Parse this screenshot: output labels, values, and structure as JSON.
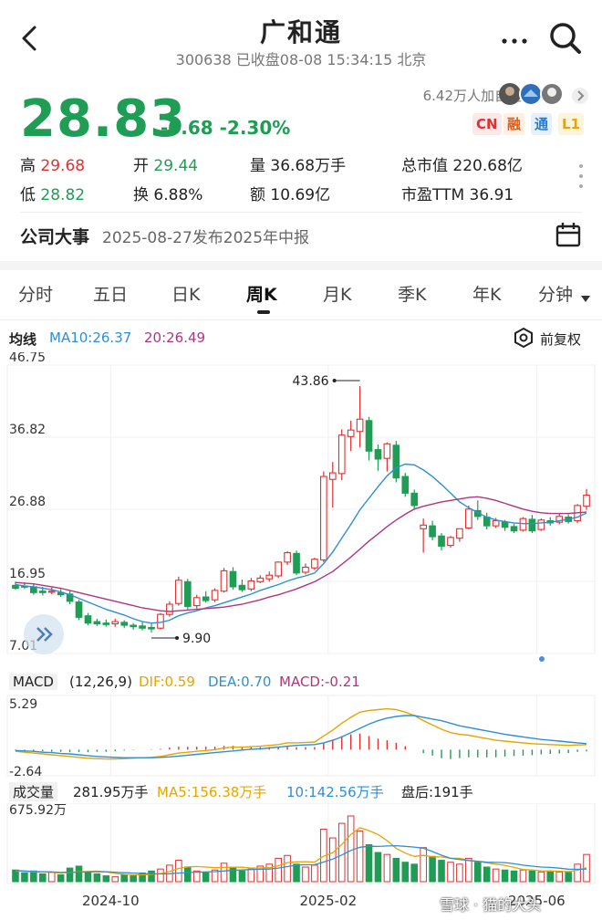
{
  "header": {
    "title": "广和通",
    "subtitle": "300638 已收盘08-08 15:34:15 北京",
    "back_icon": "back-arrow-icon",
    "more_icon": "more-dots-icon",
    "search_icon": "search-icon"
  },
  "quote": {
    "price": "28.83",
    "change": "-0.68 -2.30%",
    "followers": "6.42万人加自选",
    "badges": [
      "CN",
      "融",
      "通",
      "L1"
    ],
    "badge_colors": [
      "#e03131",
      "#e8590c",
      "#1c7ed6",
      "#e8a400"
    ],
    "stats": [
      {
        "label": "高",
        "value": "29.68",
        "color": "#e03131"
      },
      {
        "label": "开",
        "value": "29.44",
        "color": "#1f9d55"
      },
      {
        "label": "量",
        "value": "36.68万手",
        "color": "#222"
      },
      {
        "label": "总市值",
        "value": "220.68亿",
        "color": "#222"
      },
      {
        "label": "低",
        "value": "28.82",
        "color": "#1f9d55"
      },
      {
        "label": "换",
        "value": "6.88%",
        "color": "#222"
      },
      {
        "label": "额",
        "value": "10.69亿",
        "color": "#222"
      },
      {
        "label": "市盈TTM",
        "value": "36.91",
        "color": "#222"
      }
    ]
  },
  "event": {
    "label": "公司大事",
    "text": "2025-08-27发布2025年中报",
    "icon": "calendar-icon"
  },
  "tabs": [
    "分时",
    "五日",
    "日K",
    "周K",
    "月K",
    "季K",
    "年K",
    "分钟"
  ],
  "active_tab": "周K",
  "tab_dropdown_icon": "triangle-down-icon",
  "ma_bar": {
    "label": "均线",
    "ma10": "MA10:26.37",
    "ma20": "20:26.49",
    "restore": "前复权",
    "restore_icon": "hexagon-settings-icon",
    "colors": {
      "ma10": "#2f8fd6",
      "ma20": "#b0357f"
    }
  },
  "macd_bar": {
    "label": "MACD",
    "params": "(12,26,9)",
    "dif": "DIF:0.59",
    "dea": "DEA:0.70",
    "macd": "MACD:-0.21",
    "colors": {
      "dif": "#e8a400",
      "dea": "#2f8fd6",
      "macd": "#b0357f"
    }
  },
  "volume_bar": {
    "label": "成交量",
    "vol": "281.95万手",
    "ma5": "MA5:156.38万手",
    "ma10": "10:142.56万手",
    "after": "盘后:191手",
    "colors": {
      "ma5": "#e8a400",
      "ma10": "#2f8fd6"
    }
  },
  "watermark": "雪球 · 猫的大头",
  "chart_data": {
    "type": "candlestick",
    "price_axis": {
      "labels": [
        "46.75",
        "36.82",
        "26.88",
        "16.95",
        "7.01"
      ],
      "range": [
        7.01,
        46.75
      ]
    },
    "annotations": {
      "high": "43.86",
      "low": "9.90"
    },
    "candles": [
      [
        16.4,
        16.9,
        16.0,
        15.8
      ],
      [
        16.3,
        16.8,
        16.2,
        15.9
      ],
      [
        16.2,
        16.7,
        15.4,
        15.1
      ],
      [
        15.6,
        16.2,
        15.4,
        15.0
      ],
      [
        15.6,
        16.1,
        15.6,
        15.2
      ],
      [
        15.4,
        15.9,
        15.1,
        14.8
      ],
      [
        15.2,
        15.6,
        14.2,
        13.8
      ],
      [
        14.1,
        14.4,
        12.0,
        11.6
      ],
      [
        12.2,
        12.6,
        11.2,
        10.9
      ],
      [
        11.4,
        11.8,
        11.1,
        10.8
      ],
      [
        11.2,
        11.7,
        11.0,
        10.7
      ],
      [
        11.1,
        11.8,
        11.4,
        10.7
      ],
      [
        11.3,
        11.6,
        10.9,
        10.5
      ],
      [
        10.9,
        11.2,
        10.7,
        10.3
      ],
      [
        10.8,
        11.3,
        10.5,
        10.2
      ],
      [
        10.6,
        11.1,
        10.4,
        9.9
      ],
      [
        10.5,
        12.6,
        12.4,
        10.3
      ],
      [
        12.4,
        14.2,
        13.8,
        12.1
      ],
      [
        13.9,
        17.6,
        17.1,
        13.6
      ],
      [
        16.9,
        17.3,
        13.5,
        13.1
      ],
      [
        13.6,
        15.1,
        14.7,
        13.2
      ],
      [
        14.8,
        15.6,
        14.3,
        14.0
      ],
      [
        14.4,
        16.0,
        15.7,
        14.1
      ],
      [
        15.6,
        18.8,
        18.4,
        15.4
      ],
      [
        18.3,
        18.9,
        16.2,
        15.8
      ],
      [
        16.4,
        17.2,
        15.8,
        15.5
      ],
      [
        15.9,
        17.4,
        17.0,
        15.6
      ],
      [
        16.9,
        17.8,
        17.4,
        16.7
      ],
      [
        17.3,
        18.3,
        17.8,
        16.9
      ],
      [
        17.7,
        19.7,
        19.6,
        17.4
      ],
      [
        19.6,
        21.1,
        20.9,
        19.2
      ],
      [
        20.8,
        21.2,
        18.1,
        17.8
      ],
      [
        18.2,
        19.4,
        18.9,
        17.9
      ],
      [
        18.8,
        20.2,
        20.0,
        18.5
      ],
      [
        19.9,
        32.1,
        31.4,
        19.6
      ],
      [
        31.0,
        33.4,
        31.9,
        27.1
      ],
      [
        31.8,
        37.9,
        37.1,
        30.9
      ],
      [
        36.9,
        39.1,
        37.8,
        34.9
      ],
      [
        37.6,
        43.86,
        39.3,
        35.4
      ],
      [
        39.1,
        39.6,
        34.9,
        33.6
      ],
      [
        35.1,
        35.8,
        33.8,
        32.2
      ],
      [
        33.9,
        36.1,
        35.9,
        32.1
      ],
      [
        35.7,
        36.3,
        31.2,
        30.6
      ],
      [
        31.4,
        31.9,
        29.1,
        28.6
      ],
      [
        29.1,
        29.6,
        27.4,
        26.8
      ],
      [
        24.2,
        25.6,
        24.7,
        20.9
      ],
      [
        24.6,
        25.3,
        23.1,
        22.6
      ],
      [
        23.2,
        23.6,
        21.8,
        21.2
      ],
      [
        21.9,
        23.2,
        23.0,
        21.6
      ],
      [
        22.9,
        23.4,
        24.2,
        22.4
      ],
      [
        24.3,
        27.4,
        26.9,
        24.1
      ],
      [
        26.7,
        28.1,
        25.9,
        25.4
      ],
      [
        25.8,
        26.4,
        24.6,
        24.1
      ],
      [
        24.6,
        25.7,
        25.3,
        24.3
      ],
      [
        25.1,
        25.4,
        24.4,
        23.9
      ],
      [
        24.5,
        24.9,
        23.9,
        23.6
      ],
      [
        24.0,
        25.8,
        25.6,
        23.8
      ],
      [
        25.5,
        26.1,
        23.9,
        23.6
      ],
      [
        24.1,
        25.6,
        25.4,
        23.9
      ],
      [
        25.3,
        25.8,
        25.0,
        24.6
      ],
      [
        25.1,
        26.3,
        25.9,
        24.8
      ],
      [
        25.8,
        26.2,
        25.2,
        24.9
      ],
      [
        25.3,
        27.6,
        27.4,
        25.0
      ],
      [
        27.3,
        29.68,
        28.83,
        26.8
      ]
    ],
    "ma10": [
      16.5,
      16.3,
      16.2,
      16.0,
      15.8,
      15.5,
      15.1,
      14.6,
      14.1,
      13.6,
      13.1,
      12.7,
      12.3,
      11.8,
      11.4,
      11.2,
      11.3,
      11.6,
      12.2,
      12.6,
      12.9,
      13.3,
      13.6,
      14.0,
      14.4,
      14.8,
      15.2,
      15.7,
      16.1,
      16.5,
      17.0,
      17.4,
      17.7,
      18.1,
      19.4,
      21.0,
      22.9,
      24.8,
      26.8,
      28.4,
      30.0,
      31.5,
      32.6,
      33.1,
      33.0,
      32.3,
      31.4,
      30.3,
      29.1,
      27.9,
      27.1,
      26.4,
      25.8,
      25.4,
      25.2,
      25.0,
      24.9,
      24.9,
      25.0,
      25.1,
      25.3,
      25.5,
      25.8,
      26.37
    ],
    "ma20": [
      16.8,
      16.7,
      16.6,
      16.4,
      16.2,
      16.0,
      15.7,
      15.4,
      15.1,
      14.8,
      14.5,
      14.2,
      13.9,
      13.6,
      13.3,
      13.1,
      12.9,
      12.8,
      12.9,
      13.0,
      13.1,
      13.2,
      13.3,
      13.4,
      13.6,
      13.8,
      14.1,
      14.4,
      14.8,
      15.1,
      15.5,
      15.9,
      16.4,
      16.9,
      17.6,
      18.3,
      19.3,
      20.3,
      21.4,
      22.5,
      23.5,
      24.5,
      25.4,
      26.2,
      26.9,
      27.3,
      27.6,
      27.9,
      28.1,
      28.3,
      28.5,
      28.6,
      28.4,
      28.1,
      27.7,
      27.3,
      26.9,
      26.6,
      26.4,
      26.3,
      26.3,
      26.3,
      26.4,
      26.49
    ],
    "macd": {
      "axis_labels": [
        "5.29",
        "-2.64"
      ],
      "range": [
        -2.64,
        5.29
      ],
      "dif": [
        -0.2,
        -0.3,
        -0.4,
        -0.5,
        -0.6,
        -0.7,
        -0.8,
        -0.9,
        -1.0,
        -1.05,
        -1.1,
        -1.1,
        -1.05,
        -1.0,
        -0.95,
        -0.9,
        -0.8,
        -0.6,
        -0.4,
        -0.3,
        -0.2,
        -0.1,
        0.0,
        0.2,
        0.3,
        0.3,
        0.35,
        0.4,
        0.5,
        0.6,
        0.8,
        0.8,
        0.85,
        0.9,
        1.6,
        2.3,
        3.1,
        3.8,
        4.4,
        4.6,
        4.7,
        4.8,
        4.7,
        4.4,
        4.0,
        3.4,
        2.9,
        2.4,
        2.0,
        1.8,
        1.7,
        1.5,
        1.3,
        1.1,
        1.0,
        0.9,
        0.8,
        0.7,
        0.65,
        0.6,
        0.55,
        0.5,
        0.55,
        0.59
      ],
      "dea": [
        -0.1,
        -0.15,
        -0.2,
        -0.3,
        -0.35,
        -0.45,
        -0.5,
        -0.6,
        -0.7,
        -0.8,
        -0.85,
        -0.9,
        -0.95,
        -0.95,
        -0.95,
        -0.95,
        -0.9,
        -0.85,
        -0.75,
        -0.65,
        -0.55,
        -0.45,
        -0.35,
        -0.25,
        -0.15,
        -0.05,
        0.05,
        0.1,
        0.2,
        0.3,
        0.4,
        0.5,
        0.55,
        0.6,
        0.8,
        1.1,
        1.5,
        2.0,
        2.5,
        3.0,
        3.4,
        3.7,
        3.9,
        4.0,
        4.0,
        3.8,
        3.6,
        3.4,
        3.1,
        2.8,
        2.6,
        2.4,
        2.2,
        2.0,
        1.8,
        1.65,
        1.5,
        1.35,
        1.2,
        1.1,
        1.0,
        0.9,
        0.8,
        0.7
      ],
      "hist": [
        -0.1,
        -0.15,
        -0.2,
        -0.2,
        -0.25,
        -0.25,
        -0.3,
        -0.3,
        -0.3,
        -0.25,
        -0.25,
        -0.2,
        -0.1,
        -0.05,
        0.0,
        0.05,
        0.1,
        0.25,
        0.35,
        0.35,
        0.35,
        0.35,
        0.35,
        0.45,
        0.45,
        0.35,
        0.3,
        0.3,
        0.3,
        0.3,
        0.4,
        0.3,
        0.3,
        0.3,
        0.8,
        1.2,
        1.6,
        1.8,
        1.9,
        1.6,
        1.3,
        1.1,
        0.8,
        0.4,
        0.0,
        -0.4,
        -0.7,
        -1.0,
        -1.1,
        -1.0,
        -0.9,
        -0.9,
        -0.9,
        -0.9,
        -0.8,
        -0.75,
        -0.7,
        -0.65,
        -0.55,
        -0.5,
        -0.45,
        -0.4,
        -0.25,
        -0.21
      ]
    },
    "volume": {
      "axis_label": "675.92万",
      "max": 675.92,
      "values": [
        120,
        90,
        110,
        80,
        95,
        70,
        140,
        160,
        100,
        80,
        60,
        50,
        70,
        60,
        90,
        110,
        130,
        170,
        220,
        150,
        110,
        90,
        120,
        190,
        150,
        110,
        130,
        160,
        180,
        240,
        270,
        180,
        150,
        170,
        540,
        450,
        600,
        675.92,
        520,
        380,
        300,
        280,
        240,
        200,
        180,
        350,
        260,
        220,
        200,
        180,
        240,
        200,
        150,
        130,
        120,
        110,
        120,
        110,
        100,
        110,
        100,
        95,
        180,
        280
      ],
      "ma5": [
        110,
        105,
        100,
        99,
        97,
        88,
        95,
        100,
        105,
        109,
        100,
        85,
        75,
        70,
        70,
        75,
        84,
        104,
        136,
        152,
        156,
        150,
        144,
        146,
        148,
        148,
        140,
        141,
        144,
        164,
        196,
        204,
        206,
        202,
        262,
        298,
        382,
        486,
        555,
        525,
        485,
        422,
        344,
        294,
        260,
        270,
        256,
        254,
        241,
        240,
        220,
        208,
        194,
        180,
        168,
        146,
        126,
        120,
        112,
        110,
        108,
        103,
        117,
        143
      ],
      "ma10": [
        115,
        110,
        105,
        102,
        100,
        95,
        97,
        98,
        100,
        102,
        101,
        97,
        92,
        89,
        84,
        82,
        80,
        82,
        88,
        94,
        98,
        100,
        103,
        110,
        117,
        120,
        125,
        128,
        130,
        140,
        155,
        170,
        174,
        175,
        202,
        233,
        274,
        321,
        354,
        364,
        362,
        367,
        370,
        363,
        356,
        345,
        310,
        272,
        240,
        228,
        218,
        209,
        200,
        198,
        196,
        184,
        170,
        160,
        150,
        146,
        139,
        129,
        128,
        130
      ]
    },
    "x_labels": [
      "2024-10",
      "2025-02",
      "2025-06"
    ],
    "x_label_index": [
      11,
      35,
      58
    ]
  }
}
